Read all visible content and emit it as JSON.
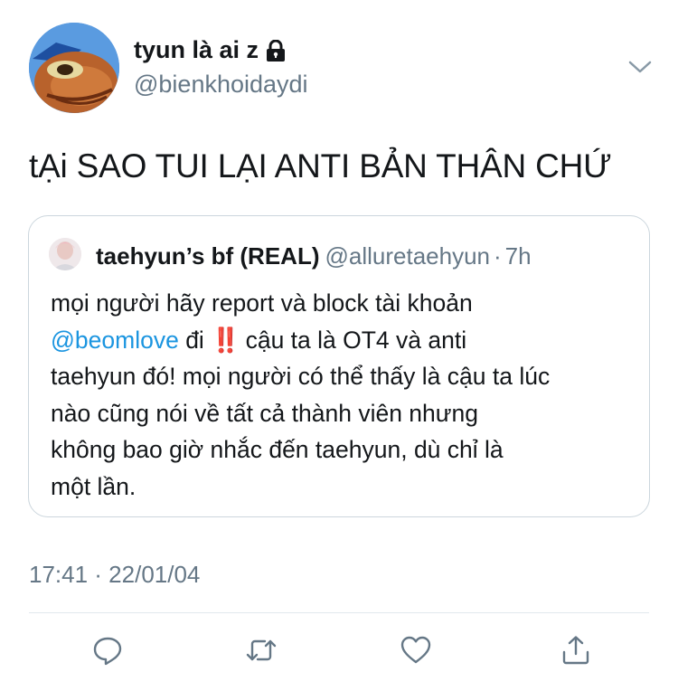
{
  "author": {
    "display_name": "tyun là ai z",
    "handle": "@bienkhoidaydi",
    "avatar_icon": "cartoon-fish-avatar-icon",
    "lock_icon": "lock-icon"
  },
  "tweet": {
    "text": "tẠi SAO TUI LẠI ANTI BẢN THÂN CHỨ",
    "timestamp": "17:41 · 22/01/04"
  },
  "quoted": {
    "display_name": "taehyun’s bf (REAL)",
    "handle": "@alluretaehyun",
    "separator": "·",
    "time": "7h",
    "lines": [
      "mọi người hãy report và block tài khoản",
      "cậu ta là OT4 và anti",
      "taehyun đó! mọi người có thể thấy là cậu ta lúc",
      "nào cũng nói về tất cả thành viên nhưng",
      "không bao giờ nhắc đến taehyun, dù chỉ là",
      "một lần."
    ],
    "mention": "@beomlove",
    "mention_suffix": "đi",
    "emoji": "‼️"
  },
  "actions": [
    "reply-icon",
    "retweet-icon",
    "like-icon",
    "share-icon"
  ],
  "colors": {
    "text": "#14171a",
    "secondary": "#657786",
    "link": "#1b95e0",
    "border": "#ccd6dd"
  }
}
